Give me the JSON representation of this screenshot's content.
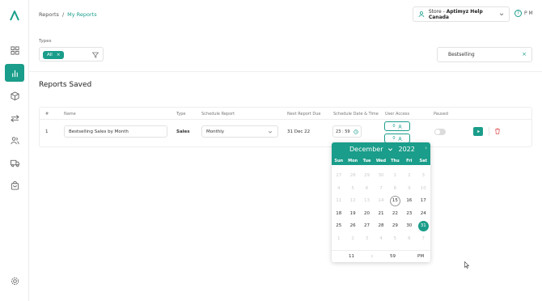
{
  "colors": {
    "accent": "#1a9d8a"
  },
  "sidebar": {
    "logo_icon": "logo-icon",
    "items": [
      {
        "icon": "dashboard-icon",
        "active": false
      },
      {
        "icon": "reports-icon",
        "active": true
      },
      {
        "icon": "products-icon",
        "active": false
      },
      {
        "icon": "transfer-icon",
        "active": false
      },
      {
        "icon": "users-icon",
        "active": false
      },
      {
        "icon": "truck-icon",
        "active": false
      },
      {
        "icon": "bag-icon",
        "active": false
      },
      {
        "icon": "settings-icon",
        "active": false
      }
    ]
  },
  "breadcrumb": {
    "root": "Reports",
    "separator": "/",
    "current": "My Reports"
  },
  "store": {
    "prefix": "Store - ",
    "name": "Aptimyz Help Canada"
  },
  "help": {
    "label": "P M"
  },
  "filters": {
    "types_label": "Types",
    "chip": {
      "label": "All",
      "close": "×"
    },
    "search_value": "Bestselling",
    "search_clear": "×"
  },
  "section_title": "Reports Saved",
  "table": {
    "headers": [
      "#",
      "Name",
      "Type",
      "Schedule Report",
      "Next Report Due",
      "Schedule Date & Time",
      "User Access",
      "Paused"
    ],
    "row": {
      "index": "1",
      "name": "Bestselling Sales by Month",
      "type": "Sales",
      "schedule": "Monthly",
      "next_due": "31 Dec 22",
      "time": "23 : 59",
      "access_1": "0",
      "access_2": "0",
      "paused": false
    }
  },
  "datepicker": {
    "month": "December",
    "year": "2022",
    "next_label": "›",
    "weekdays": [
      "Sun",
      "Mon",
      "Tue",
      "Wed",
      "Thu",
      "Fri",
      "Sat"
    ],
    "weeks": [
      [
        [
          "27",
          "m"
        ],
        [
          "28",
          "m"
        ],
        [
          "29",
          "m"
        ],
        [
          "30",
          "m"
        ],
        [
          "1",
          "m"
        ],
        [
          "2",
          "m"
        ],
        [
          "3",
          "m"
        ]
      ],
      [
        [
          "4",
          "m"
        ],
        [
          "5",
          "m"
        ],
        [
          "6",
          "m"
        ],
        [
          "7",
          "m"
        ],
        [
          "8",
          "m"
        ],
        [
          "9",
          "m"
        ],
        [
          "10",
          "m"
        ]
      ],
      [
        [
          "11",
          "m"
        ],
        [
          "12",
          "m"
        ],
        [
          "13",
          "m"
        ],
        [
          "14",
          "m"
        ],
        [
          "15",
          "t"
        ],
        [
          "16",
          ""
        ],
        [
          "17",
          ""
        ]
      ],
      [
        [
          "18",
          ""
        ],
        [
          "19",
          ""
        ],
        [
          "20",
          ""
        ],
        [
          "21",
          ""
        ],
        [
          "22",
          ""
        ],
        [
          "23",
          ""
        ],
        [
          "24",
          ""
        ]
      ],
      [
        [
          "25",
          ""
        ],
        [
          "26",
          ""
        ],
        [
          "27",
          ""
        ],
        [
          "28",
          ""
        ],
        [
          "29",
          ""
        ],
        [
          "30",
          ""
        ],
        [
          "31",
          "s"
        ]
      ],
      [
        [
          "1",
          "m"
        ],
        [
          "2",
          "m"
        ],
        [
          "3",
          "m"
        ],
        [
          "4",
          "m"
        ],
        [
          "5",
          "m"
        ],
        [
          "6",
          "m"
        ],
        [
          "7",
          "m"
        ]
      ]
    ],
    "time": {
      "hour": "11",
      "sep": ":",
      "minute": "59",
      "meridiem": "PM"
    }
  }
}
